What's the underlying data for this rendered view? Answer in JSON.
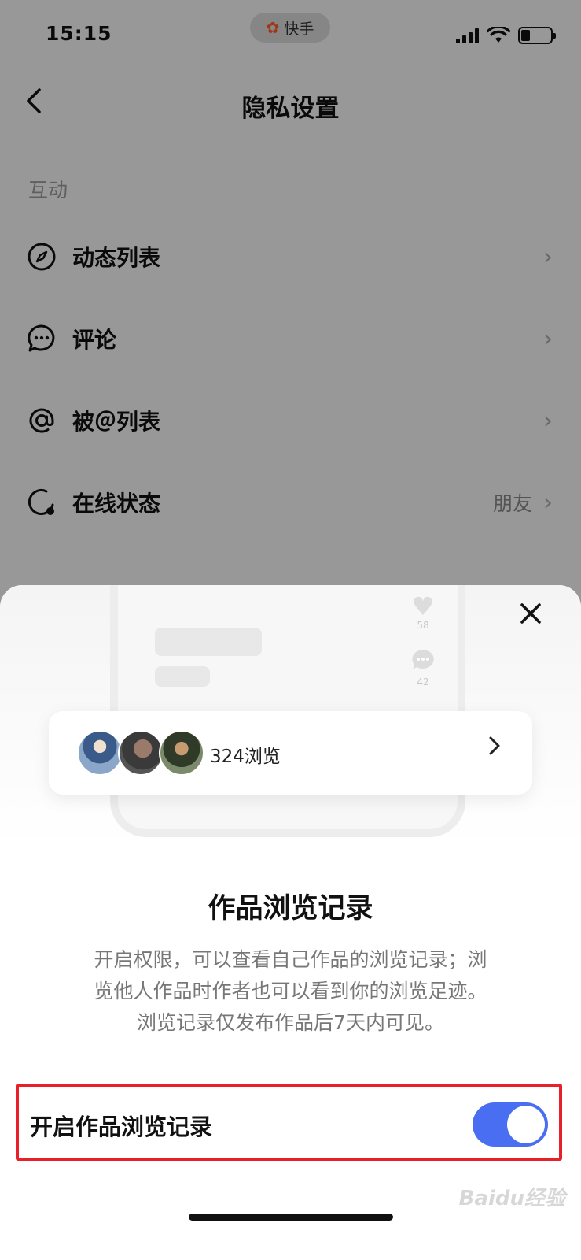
{
  "status_bar": {
    "time": "15:15",
    "app_name": "快手",
    "app_logo_glyph": "✿",
    "battery_level": 0.3
  },
  "nav": {
    "title": "隐私设置"
  },
  "section": {
    "label": "互动"
  },
  "menu": [
    {
      "id": "feed",
      "label": "动态列表",
      "value": "",
      "icon": "compass-icon"
    },
    {
      "id": "comments",
      "label": "评论",
      "value": "",
      "icon": "chat-bubble-icon"
    },
    {
      "id": "mentions",
      "label": "被＠列表",
      "value": "",
      "icon": "at-icon"
    },
    {
      "id": "online",
      "label": "在线状态",
      "value": "朋友",
      "icon": "online-status-icon"
    }
  ],
  "sheet": {
    "preview": {
      "like_count": "58",
      "comment_count": "42",
      "views_label": "324浏览"
    },
    "title": "作品浏览记录",
    "description_lines": [
      "开启权限，可以查看自己作品的浏览记录；浏",
      "览他人作品时作者也可以看到你的浏览足迹。",
      "浏览记录仅发布作品后7天内可见。"
    ],
    "toggle": {
      "label": "开启作品浏览记录",
      "on": true
    },
    "accent_color": "#4a6ef2",
    "highlight_color": "#e8202a"
  },
  "watermark": "Baidu经验"
}
